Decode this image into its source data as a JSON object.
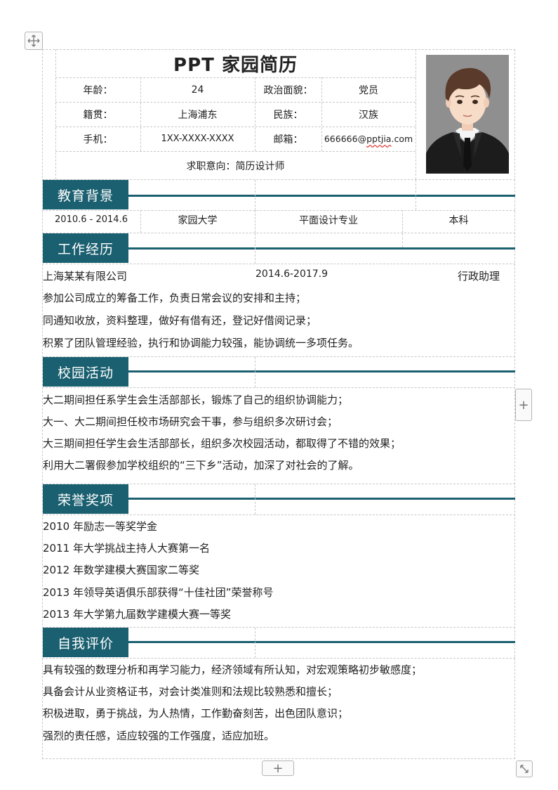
{
  "header": {
    "title": "PPT 家园简历",
    "rows": [
      {
        "label1": "年龄：",
        "value1": "24",
        "label2": "政治面貌：",
        "value2": "党员"
      },
      {
        "label1": "籍贯：",
        "value1": "上海浦东",
        "label2": "民族：",
        "value2": "汉族"
      },
      {
        "label1": "手机：",
        "value1": "1XX-XXXX-XXXX",
        "label2": "邮箱：",
        "value2_prefix": "666666@",
        "value2_underlined": "pptjia",
        "value2_suffix": ".com"
      }
    ],
    "intention": "求职意向：简历设计师"
  },
  "sections": {
    "education": {
      "title": "教育背景",
      "row": {
        "period": "2010.6 - 2014.6",
        "school": "家园大学",
        "major": "平面设计专业",
        "degree": "本科"
      }
    },
    "work": {
      "title": "工作经历",
      "company": "上海某某有限公司",
      "period": "2014.6-2017.9",
      "position": "行政助理",
      "lines": [
        "参加公司成立的筹备工作，负责日常会议的安排和主持；",
        "同通知收放，资料整理，做好有借有还，登记好借阅记录；",
        "积累了团队管理经验，执行和协调能力较强，能协调统一多项任务。"
      ]
    },
    "campus": {
      "title": "校园活动",
      "lines": [
        "大二期间担任系学生会生活部部长，锻炼了自己的组织协调能力；",
        "大一、大二期间担任校市场研究会干事，参与组织多次研讨会；",
        "大三期间担任学生会生活部部长，组织多次校园活动，都取得了不错的效果；",
        "利用大二署假参加学校组织的“三下乡”活动，加深了对社会的了解。"
      ]
    },
    "honors": {
      "title": "荣誉奖项",
      "lines": [
        "2010 年励志一等奖学金",
        "2011 年大学挑战主持人大赛第一名",
        "2012 年数学建模大赛国家二等奖",
        "2013 年领导英语俱乐部获得“十佳社团”荣誉称号",
        "2013 年大学第九届数学建模大赛一等奖"
      ]
    },
    "self": {
      "title": "自我评价",
      "lines": [
        "具有较强的数理分析和再学习能力，经济领域有所认知，对宏观策略初步敏感度；",
        "具备会计从业资格证书，对会计类准则和法规比较熟悉和擅长；",
        "积极进取，勇于挑战，为人热情，工作勤奋刻苦，出色团队意识；",
        "强烈的责任感，适应较强的工作强度，适应加班。"
      ]
    }
  },
  "colors": {
    "accent": "#1b6070",
    "grid": "#c8c8c8"
  },
  "icons": {
    "move": "move-icon",
    "add_column": "plus-icon",
    "add_row": "plus-icon",
    "resize": "resize-icon"
  }
}
